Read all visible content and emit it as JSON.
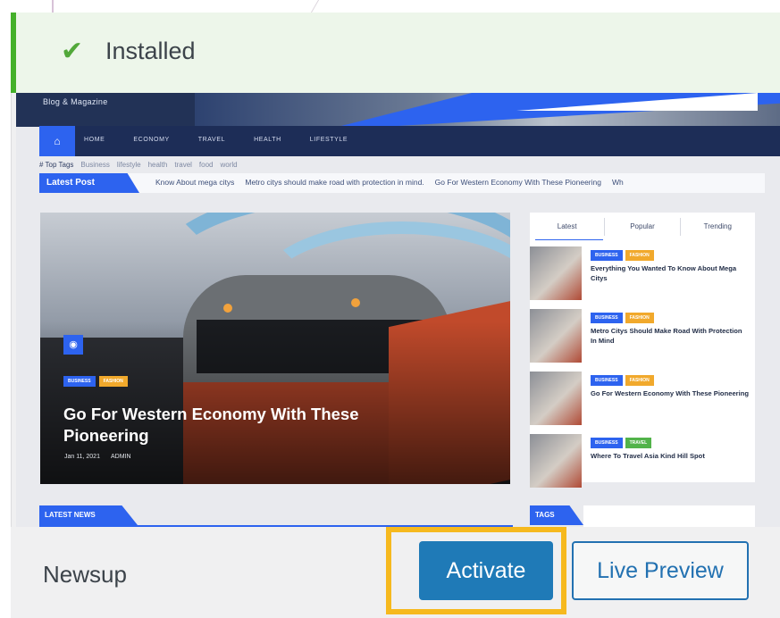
{
  "notice": {
    "icon": "check-icon",
    "text": "Installed",
    "color": "#44b02a"
  },
  "preview": {
    "brand": "Blog & Magazine",
    "nav": {
      "home_icon": "home-icon",
      "items": [
        "HOME",
        "ECONOMY",
        "TRAVEL",
        "HEALTH",
        "LIFESTYLE"
      ]
    },
    "top_tags": [
      "# Top Tags",
      "Business",
      "lifestyle",
      "health",
      "travel",
      "food",
      "world"
    ],
    "latest_label": "Latest Post",
    "latest_items": [
      "Know About mega citys",
      "Metro citys should make road with protection in mind.",
      "Go For Western Economy With These Pioneering",
      "Wh"
    ],
    "hero": {
      "camera_icon": "camera-icon",
      "badges": [
        "BUSINESS",
        "FASHION"
      ],
      "title": "Go For Western Economy With These Pioneering",
      "date": "Jan 11, 2021",
      "author": "ADMIN"
    },
    "tabs": [
      "Latest",
      "Popular",
      "Trending"
    ],
    "posts": [
      {
        "badges": [
          "BUSINESS",
          "FASHION"
        ],
        "title": "Everything You Wanted To Know About Mega Citys"
      },
      {
        "badges": [
          "BUSINESS",
          "FASHION"
        ],
        "title": "Metro Citys Should Make Road With Protection In Mind"
      },
      {
        "badges": [
          "BUSINESS",
          "FASHION"
        ],
        "title": "Go For Western Economy With These Pioneering"
      },
      {
        "badges": [
          "BUSINESS",
          "TRAVEL"
        ],
        "title": "Where To Travel Asia Kind Hill Spot"
      }
    ],
    "latest_news": "LATEST NEWS",
    "tags": "TAGS"
  },
  "theme": {
    "name": "Newsup",
    "activate": "Activate",
    "live_preview": "Live Preview",
    "highlight_color": "#f6b91e"
  }
}
